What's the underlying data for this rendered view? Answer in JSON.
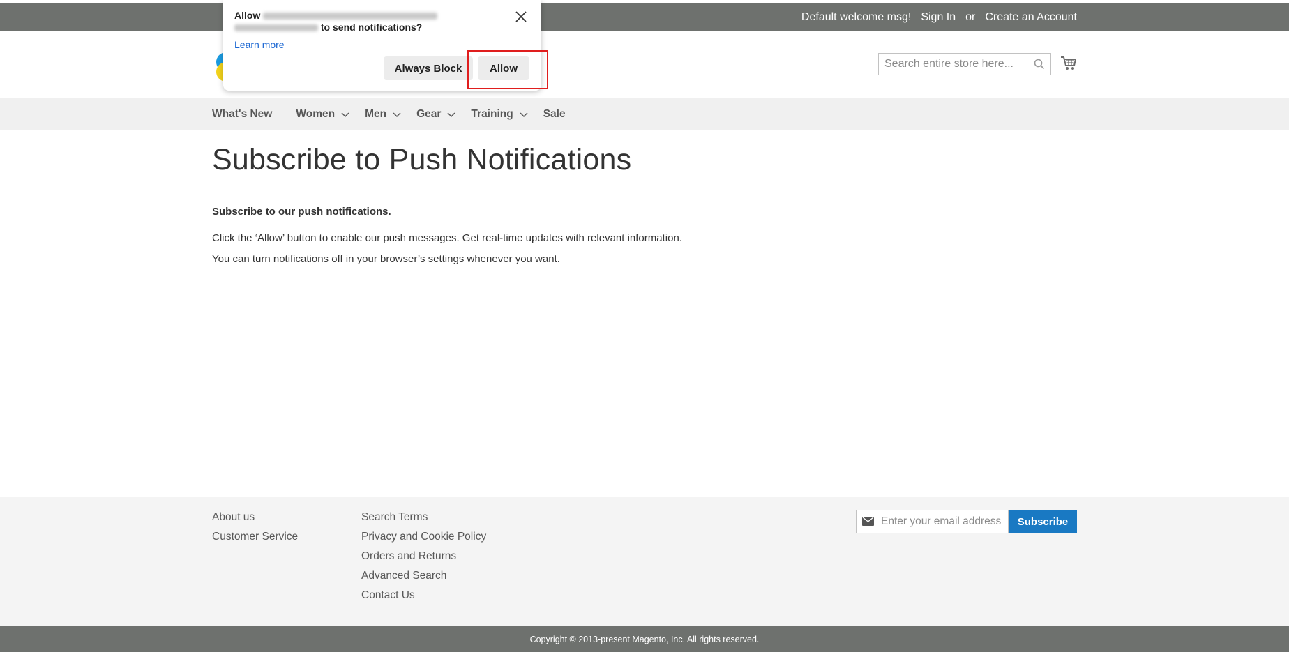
{
  "top_bar": {
    "welcome": "Default welcome msg!",
    "sign_in": "Sign In",
    "or": "or",
    "create_account": "Create an Account"
  },
  "header": {
    "search_placeholder": "Search entire store here...",
    "logo_icon": "store-logo",
    "cart_icon": "shopping-cart-icon"
  },
  "nav": {
    "items": [
      {
        "label": "What's New",
        "has_submenu": false
      },
      {
        "label": "Women",
        "has_submenu": true
      },
      {
        "label": "Men",
        "has_submenu": true
      },
      {
        "label": "Gear",
        "has_submenu": true
      },
      {
        "label": "Training",
        "has_submenu": true
      },
      {
        "label": "Sale",
        "has_submenu": false
      }
    ]
  },
  "main": {
    "title": "Subscribe to Push Notifications",
    "intro": "Subscribe to our push notifications.",
    "p1": "Click the ‘Allow’ button to enable our push messages. Get real-time updates with relevant information.",
    "p2": "You can turn notifications off in your browser’s settings whenever you want."
  },
  "footer": {
    "col1": [
      "About us",
      "Customer Service"
    ],
    "col2": [
      "Search Terms",
      "Privacy and Cookie Policy",
      "Orders and Returns",
      "Advanced Search",
      "Contact Us"
    ],
    "newsletter_placeholder": "Enter your email address",
    "subscribe_label": "Subscribe",
    "copyright": "Copyright © 2013-present Magento, Inc. All rights reserved."
  },
  "popup": {
    "allow_prefix": "Allow",
    "suffix": "to send notifications?",
    "learn_more": "Learn more",
    "always_block": "Always Block",
    "allow": "Allow"
  },
  "colors": {
    "top_bar_bg": "#6e716e",
    "nav_bg": "#f0f0f0",
    "footer_bg": "#f4f4f4",
    "accent": "#1979c3",
    "highlight": "#e01e1e"
  }
}
